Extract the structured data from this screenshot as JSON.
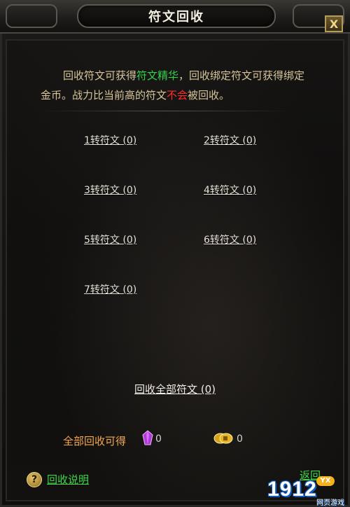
{
  "window": {
    "title": "符文回收",
    "close_label": "X"
  },
  "description": {
    "part1": "回收符文可获得",
    "highlight_green": "符文精华",
    "part2": "，回收绑定符文可获得绑定金币。战力比当前高的符文",
    "highlight_red": "不会",
    "part3": "被回收。"
  },
  "runes": [
    {
      "label": "1转符文 (0)"
    },
    {
      "label": "2转符文 (0)"
    },
    {
      "label": "3转符文 (0)"
    },
    {
      "label": "4转符文 (0)"
    },
    {
      "label": "5转符文 (0)"
    },
    {
      "label": "6转符文 (0)"
    },
    {
      "label": "7转符文 (0)"
    }
  ],
  "actions": {
    "recycle_all": "回收全部符文 (0)"
  },
  "summary": {
    "label": "全部回收可得",
    "crystal_amount": "0",
    "coin_amount": "0"
  },
  "footer": {
    "help_icon": "?",
    "help_label": "回收说明",
    "back_label": "返回"
  },
  "watermark": {
    "text": "1912",
    "badge": "YX",
    "subtext": "网页游戏"
  },
  "colors": {
    "accent_green": "#34d14a",
    "accent_red": "#ff2b2b",
    "summary_orange": "#f3a74b"
  }
}
